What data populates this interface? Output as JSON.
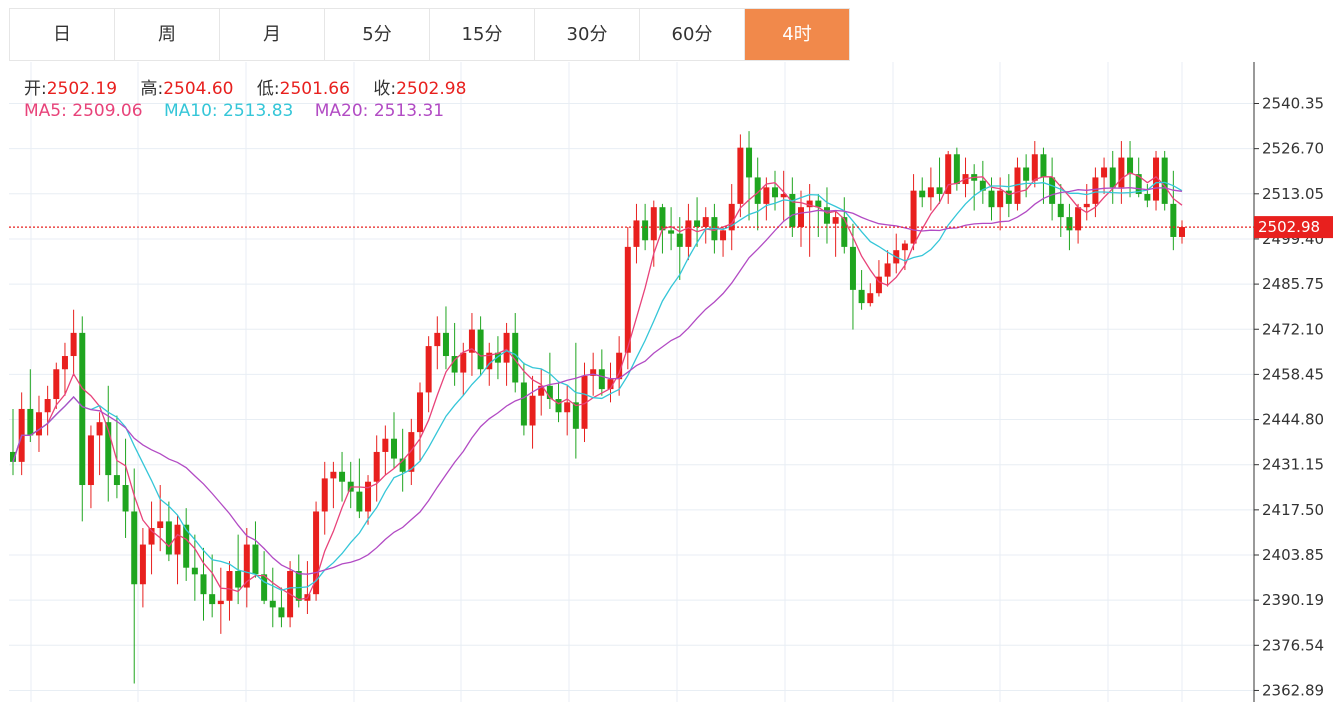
{
  "tabs": [
    {
      "label": "日",
      "active": false
    },
    {
      "label": "周",
      "active": false
    },
    {
      "label": "月",
      "active": false
    },
    {
      "label": "5分",
      "active": false
    },
    {
      "label": "15分",
      "active": false
    },
    {
      "label": "30分",
      "active": false
    },
    {
      "label": "60分",
      "active": false
    },
    {
      "label": "4时",
      "active": true
    }
  ],
  "ohlc": {
    "open_label": "开:",
    "open_value": "2502.19",
    "high_label": "高:",
    "high_value": "2504.60",
    "low_label": "低:",
    "low_value": "2501.66",
    "close_label": "收:",
    "close_value": "2502.98"
  },
  "ma": {
    "ma5_label": "MA5:",
    "ma5_value": "2509.06",
    "ma10_label": "MA10:",
    "ma10_value": "2513.83",
    "ma20_label": "MA20:",
    "ma20_value": "2513.31"
  },
  "colors": {
    "up": "#e8201e",
    "down": "#1fa51f",
    "ma5": "#e8437a",
    "ma10": "#35c6d8",
    "ma20": "#b24bc4",
    "active_tab": "#f1894b",
    "grid": "#e8eef4",
    "price_line": "#e8201e"
  },
  "chart_data": {
    "type": "candlestick",
    "y_ticks": [
      "2540.35",
      "2526.70",
      "2513.05",
      "2499.40",
      "2485.75",
      "2472.10",
      "2458.45",
      "2444.80",
      "2431.15",
      "2417.50",
      "2403.85",
      "2390.19",
      "2376.54",
      "2362.89"
    ],
    "ylim": [
      2362.89,
      2540.35
    ],
    "last_price": "2502.98",
    "candles": [
      [
        2435,
        2448,
        2428,
        2432
      ],
      [
        2432,
        2453,
        2428,
        2448
      ],
      [
        2448,
        2460,
        2438,
        2440
      ],
      [
        2440,
        2452,
        2435,
        2447
      ],
      [
        2447,
        2455,
        2440,
        2451
      ],
      [
        2451,
        2462,
        2448,
        2460
      ],
      [
        2460,
        2468,
        2452,
        2464
      ],
      [
        2464,
        2478,
        2458,
        2471
      ],
      [
        2471,
        2476,
        2414,
        2425
      ],
      [
        2425,
        2443,
        2418,
        2440
      ],
      [
        2440,
        2447,
        2428,
        2444
      ],
      [
        2444,
        2455,
        2420,
        2428
      ],
      [
        2428,
        2446,
        2421,
        2425
      ],
      [
        2425,
        2439,
        2409,
        2417
      ],
      [
        2417,
        2430,
        2365,
        2395
      ],
      [
        2395,
        2412,
        2388,
        2407
      ],
      [
        2407,
        2420,
        2398,
        2412
      ],
      [
        2412,
        2425,
        2405,
        2414
      ],
      [
        2414,
        2420,
        2402,
        2404
      ],
      [
        2404,
        2416,
        2395,
        2413
      ],
      [
        2413,
        2418,
        2396,
        2400
      ],
      [
        2400,
        2410,
        2390,
        2398
      ],
      [
        2398,
        2406,
        2384,
        2392
      ],
      [
        2392,
        2404,
        2385,
        2389
      ],
      [
        2389,
        2400,
        2380,
        2390
      ],
      [
        2390,
        2402,
        2384,
        2399
      ],
      [
        2399,
        2410,
        2389,
        2394
      ],
      [
        2394,
        2412,
        2388,
        2407
      ],
      [
        2407,
        2414,
        2397,
        2398
      ],
      [
        2398,
        2405,
        2389,
        2390
      ],
      [
        2390,
        2400,
        2382,
        2388
      ],
      [
        2388,
        2394,
        2382,
        2385
      ],
      [
        2385,
        2402,
        2382,
        2399
      ],
      [
        2399,
        2404,
        2388,
        2390
      ],
      [
        2390,
        2402,
        2386,
        2392
      ],
      [
        2392,
        2420,
        2390,
        2417
      ],
      [
        2417,
        2432,
        2410,
        2427
      ],
      [
        2427,
        2432,
        2418,
        2429
      ],
      [
        2429,
        2435,
        2420,
        2426
      ],
      [
        2426,
        2432,
        2418,
        2423
      ],
      [
        2423,
        2433,
        2415,
        2417
      ],
      [
        2417,
        2428,
        2413,
        2426
      ],
      [
        2426,
        2440,
        2420,
        2435
      ],
      [
        2435,
        2443,
        2428,
        2439
      ],
      [
        2439,
        2447,
        2430,
        2433
      ],
      [
        2433,
        2442,
        2423,
        2429
      ],
      [
        2429,
        2445,
        2425,
        2441
      ],
      [
        2441,
        2456,
        2432,
        2453
      ],
      [
        2453,
        2470,
        2447,
        2467
      ],
      [
        2467,
        2476,
        2460,
        2471
      ],
      [
        2471,
        2479,
        2460,
        2464
      ],
      [
        2464,
        2474,
        2455,
        2459
      ],
      [
        2459,
        2468,
        2452,
        2465
      ],
      [
        2465,
        2477,
        2458,
        2472
      ],
      [
        2472,
        2476,
        2458,
        2460
      ],
      [
        2460,
        2468,
        2455,
        2465
      ],
      [
        2465,
        2470,
        2457,
        2462
      ],
      [
        2462,
        2474,
        2455,
        2471
      ],
      [
        2471,
        2477,
        2453,
        2456
      ],
      [
        2456,
        2462,
        2440,
        2443
      ],
      [
        2443,
        2458,
        2436,
        2452
      ],
      [
        2452,
        2460,
        2446,
        2455
      ],
      [
        2455,
        2465,
        2448,
        2451
      ],
      [
        2451,
        2456,
        2444,
        2447
      ],
      [
        2447,
        2455,
        2440,
        2450
      ],
      [
        2450,
        2468,
        2433,
        2442
      ],
      [
        2442,
        2462,
        2438,
        2458
      ],
      [
        2458,
        2465,
        2452,
        2460
      ],
      [
        2460,
        2466,
        2452,
        2454
      ],
      [
        2454,
        2462,
        2450,
        2457
      ],
      [
        2457,
        2470,
        2452,
        2465
      ],
      [
        2465,
        2503,
        2460,
        2497
      ],
      [
        2497,
        2510,
        2492,
        2505
      ],
      [
        2505,
        2510,
        2496,
        2499
      ],
      [
        2499,
        2511,
        2491,
        2509
      ],
      [
        2509,
        2510,
        2495,
        2502
      ],
      [
        2502,
        2509,
        2496,
        2501
      ],
      [
        2501,
        2506,
        2487,
        2497
      ],
      [
        2497,
        2510,
        2493,
        2505
      ],
      [
        2505,
        2512,
        2497,
        2503
      ],
      [
        2503,
        2509,
        2498,
        2506
      ],
      [
        2506,
        2510,
        2495,
        2499
      ],
      [
        2499,
        2503,
        2494,
        2502
      ],
      [
        2502,
        2516,
        2496,
        2510
      ],
      [
        2510,
        2531,
        2506,
        2527
      ],
      [
        2527,
        2532,
        2505,
        2518
      ],
      [
        2518,
        2524,
        2502,
        2510
      ],
      [
        2510,
        2518,
        2505,
        2515
      ],
      [
        2515,
        2520,
        2508,
        2512
      ],
      [
        2512,
        2520,
        2505,
        2513
      ],
      [
        2513,
        2518,
        2500,
        2503
      ],
      [
        2503,
        2514,
        2497,
        2509
      ],
      [
        2509,
        2516,
        2494,
        2511
      ],
      [
        2511,
        2513,
        2500,
        2509
      ],
      [
        2509,
        2515,
        2498,
        2504
      ],
      [
        2504,
        2508,
        2494,
        2506
      ],
      [
        2506,
        2512,
        2495,
        2497
      ],
      [
        2497,
        2504,
        2472,
        2484
      ],
      [
        2484,
        2490,
        2478,
        2480
      ],
      [
        2480,
        2486,
        2479,
        2483
      ],
      [
        2483,
        2493,
        2482,
        2488
      ],
      [
        2488,
        2496,
        2485,
        2492
      ],
      [
        2492,
        2501,
        2489,
        2496
      ],
      [
        2496,
        2499,
        2490,
        2498
      ],
      [
        2498,
        2519,
        2496,
        2514
      ],
      [
        2514,
        2518,
        2509,
        2512
      ],
      [
        2512,
        2521,
        2508,
        2515
      ],
      [
        2515,
        2524,
        2510,
        2513
      ],
      [
        2513,
        2526,
        2510,
        2525
      ],
      [
        2525,
        2527,
        2514,
        2516
      ],
      [
        2516,
        2524,
        2512,
        2519
      ],
      [
        2519,
        2522,
        2508,
        2517
      ],
      [
        2517,
        2523,
        2510,
        2514
      ],
      [
        2514,
        2518,
        2505,
        2509
      ],
      [
        2509,
        2518,
        2502,
        2514
      ],
      [
        2514,
        2519,
        2506,
        2510
      ],
      [
        2510,
        2524,
        2508,
        2521
      ],
      [
        2521,
        2525,
        2512,
        2517
      ],
      [
        2517,
        2529,
        2515,
        2525
      ],
      [
        2525,
        2527,
        2510,
        2518
      ],
      [
        2518,
        2524,
        2505,
        2510
      ],
      [
        2510,
        2516,
        2500,
        2506
      ],
      [
        2506,
        2510,
        2496,
        2502
      ],
      [
        2502,
        2510,
        2498,
        2509
      ],
      [
        2509,
        2516,
        2505,
        2510
      ],
      [
        2510,
        2521,
        2506,
        2518
      ],
      [
        2518,
        2524,
        2513,
        2521
      ],
      [
        2521,
        2526,
        2510,
        2515
      ],
      [
        2515,
        2529,
        2510,
        2524
      ],
      [
        2524,
        2529,
        2512,
        2519
      ],
      [
        2519,
        2524,
        2512,
        2513
      ],
      [
        2513,
        2516,
        2509,
        2511
      ],
      [
        2511,
        2526,
        2508,
        2524
      ],
      [
        2524,
        2526,
        2508,
        2510
      ],
      [
        2510,
        2520,
        2496,
        2500
      ],
      [
        2500,
        2505,
        2498,
        2503
      ]
    ]
  }
}
